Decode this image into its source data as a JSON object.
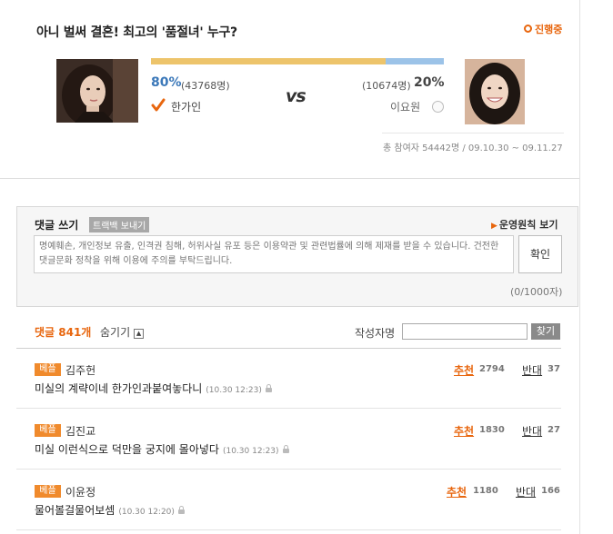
{
  "poll": {
    "title": "아니 벌써 결혼! 최고의 '품절녀' 누구?",
    "status": "진행중",
    "left": {
      "percent": "80%",
      "count": "(43768명)",
      "name": "한가인",
      "share": 0.8
    },
    "vs": "vs",
    "right": {
      "percent": "20%",
      "count": "(10674명)",
      "name": "이요원"
    },
    "meta": "총 참여자 54442명 / 09.10.30 ~ 09.11.27",
    "colors": {
      "left_bar": "#edc46b",
      "right_bar": "#9cc3e8",
      "accent": "#e8660e"
    }
  },
  "comment_form": {
    "title": "댓글 쓰기",
    "trackback": "트랙백 보내기",
    "rules_link": "운영원칙 보기",
    "placeholder": "명예훼손, 개인정보 유출, 인격권 침해, 허위사실 유포 등은 이용약관 및 관련법률에 의해 제재를 받을 수 있습니다. 건전한 댓글문화 정착을 위해 이용에 주의를 부탁드립니다.",
    "submit": "확인",
    "char_count": "(0/1000자)"
  },
  "list_header": {
    "count": "댓글 841개",
    "hide": "숨기기",
    "author_label": "작성자명",
    "search": "찾기"
  },
  "comments": [
    {
      "badge": "베플",
      "author": "김주헌",
      "text": "미실의 계략이네 한가인과붙여놓다니",
      "time": "(10.30 12:23)",
      "up_label": "추천",
      "up": "2794",
      "down_label": "반대",
      "down": "37"
    },
    {
      "badge": "베플",
      "author": "김진교",
      "text": "미실 이런식으로 덕만을 궁지에 몰아넣다",
      "time": "(10.30 12:23)",
      "up_label": "추천",
      "up": "1830",
      "down_label": "반대",
      "down": "27"
    },
    {
      "badge": "베플",
      "author": "이윤정",
      "text": "물어볼걸물어보셈",
      "time": "(10.30 12:20)",
      "up_label": "추천",
      "up": "1180",
      "down_label": "반대",
      "down": "166"
    }
  ]
}
